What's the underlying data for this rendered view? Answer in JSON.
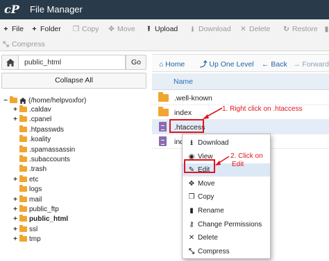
{
  "app": {
    "logo": "cP",
    "title": "File Manager"
  },
  "toolbar": {
    "row1": [
      {
        "icon": "plus-icon",
        "glyph": "+",
        "label": "File",
        "enabled": true
      },
      {
        "icon": "plus-icon",
        "glyph": "+",
        "label": "Folder",
        "enabled": true
      },
      {
        "icon": "copy-icon",
        "glyph": "❐",
        "label": "Copy",
        "enabled": false
      },
      {
        "icon": "move-icon",
        "glyph": "✥",
        "label": "Move",
        "enabled": false
      },
      {
        "icon": "upload-icon",
        "glyph": "⭱",
        "label": "Upload",
        "enabled": true
      },
      {
        "icon": "download-icon",
        "glyph": "⭳",
        "label": "Download",
        "enabled": false
      },
      {
        "icon": "delete-icon",
        "glyph": "✕",
        "label": "Delete",
        "enabled": false
      },
      {
        "icon": "restore-icon",
        "glyph": "↻",
        "label": "Restore",
        "enabled": false
      },
      {
        "icon": "rename-icon",
        "glyph": "▮",
        "label": "",
        "enabled": false
      }
    ],
    "row2": [
      {
        "icon": "compress-icon",
        "glyph": "⤡",
        "label": "Compress",
        "enabled": false
      }
    ]
  },
  "left": {
    "path_value": "public_html",
    "go_label": "Go",
    "collapse_label": "Collapse All",
    "tree_root": "(/home/helpvoxfor)",
    "tree": [
      {
        "label": ".caldav",
        "expandable": true,
        "bold": false
      },
      {
        "label": ".cpanel",
        "expandable": true,
        "bold": false
      },
      {
        "label": ".htpasswds",
        "expandable": false,
        "bold": false
      },
      {
        "label": ".koality",
        "expandable": false,
        "bold": false
      },
      {
        "label": ".spamassassin",
        "expandable": false,
        "bold": false
      },
      {
        "label": ".subaccounts",
        "expandable": false,
        "bold": false
      },
      {
        "label": ".trash",
        "expandable": false,
        "bold": false
      },
      {
        "label": "etc",
        "expandable": true,
        "bold": false
      },
      {
        "label": "logs",
        "expandable": false,
        "bold": false
      },
      {
        "label": "mail",
        "expandable": true,
        "bold": false
      },
      {
        "label": "public_ftp",
        "expandable": true,
        "bold": false
      },
      {
        "label": "public_html",
        "expandable": true,
        "bold": true
      },
      {
        "label": "ssl",
        "expandable": true,
        "bold": false
      },
      {
        "label": "tmp",
        "expandable": true,
        "bold": false
      }
    ]
  },
  "right": {
    "nav": [
      {
        "icon": "home-icon",
        "glyph": "⌂",
        "label": "Home",
        "enabled": true
      },
      {
        "icon": "up-one-level-icon",
        "glyph": "⤴",
        "label": "Up One Level",
        "enabled": true
      },
      {
        "icon": "back-icon",
        "glyph": "←",
        "label": "Back",
        "enabled": true
      },
      {
        "icon": "forward-icon",
        "glyph": "→",
        "label": "Forward",
        "enabled": false
      }
    ],
    "column_name": "Name",
    "files": [
      {
        "name": ".well-known",
        "type": "folder",
        "selected": false
      },
      {
        "name": "index",
        "type": "folder",
        "selected": false
      },
      {
        "name": ".htaccess",
        "type": "file",
        "selected": true
      },
      {
        "name": "ind",
        "type": "file",
        "selected": false
      }
    ]
  },
  "context_menu": [
    {
      "icon": "download-icon",
      "glyph": "⭳",
      "label": "Download",
      "highlighted": false
    },
    {
      "icon": "eye-icon",
      "glyph": "◉",
      "label": "View",
      "highlighted": false
    },
    {
      "icon": "pencil-icon",
      "glyph": "✎",
      "label": "Edit",
      "highlighted": true
    },
    {
      "icon": "move-icon",
      "glyph": "✥",
      "label": "Move",
      "highlighted": false
    },
    {
      "icon": "copy-icon",
      "glyph": "❐",
      "label": "Copy",
      "highlighted": false
    },
    {
      "icon": "rename-icon",
      "glyph": "▮",
      "label": "Rename",
      "highlighted": false
    },
    {
      "icon": "key-icon",
      "glyph": "⚷",
      "label": "Change Permissions",
      "highlighted": false
    },
    {
      "icon": "delete-icon",
      "glyph": "✕",
      "label": "Delete",
      "highlighted": false
    },
    {
      "icon": "compress-icon",
      "glyph": "⤡",
      "label": "Compress",
      "highlighted": false
    }
  ],
  "annotations": {
    "step1": "1. Right click on .htaccess",
    "step2_line1": "2. Click on",
    "step2_line2": "Edit"
  },
  "colors": {
    "titlebar": "#293a4a",
    "accent": "#1d63a6",
    "annotation": "#e0141e",
    "folder": "#f0a630",
    "file": "#8b6bb1"
  }
}
